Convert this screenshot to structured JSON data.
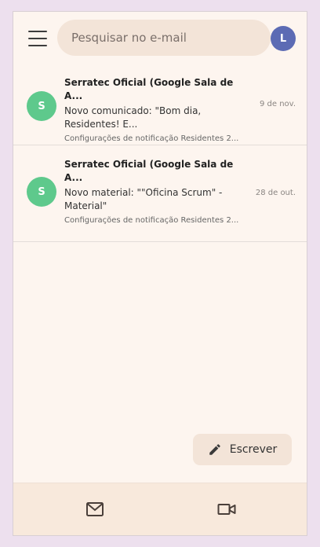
{
  "header": {
    "search_placeholder": "Pesquisar no e-mail",
    "account_initial": "L"
  },
  "emails": [
    {
      "avatar_initial": "S",
      "sender": "Serratec Oficial (Google Sala de A...",
      "subject": "Novo comunicado: \"Bom dia, Residentes! E...",
      "snippet": "Configurações de notificação Residentes 2...",
      "date": "9 de nov."
    },
    {
      "avatar_initial": "S",
      "sender": "Serratec Oficial (Google Sala de A...",
      "subject": "Novo material: \"\"Oficina Scrum\" - Material\"",
      "snippet": "Configurações de notificação Residentes 2...",
      "date": "28 de out."
    }
  ],
  "compose": {
    "label": "Escrever"
  },
  "bottom_nav": {
    "items": [
      "mail-icon",
      "video-icon"
    ]
  },
  "colors": {
    "background": "#ede0ee",
    "surface": "#fdf5ef",
    "search_bg": "#f3e4d8",
    "account_avatar": "#5c6bb4",
    "sender_avatar": "#5ec98c",
    "nav_bg": "#f8e9dc"
  }
}
